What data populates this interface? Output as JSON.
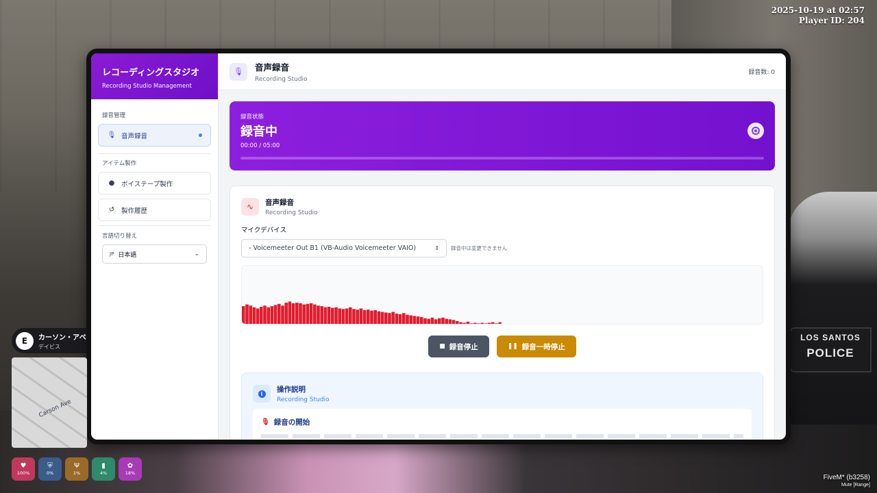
{
  "hud": {
    "datetime": "2025-10-19 at 02:57",
    "player_id": "Player ID: 204",
    "fivem": "FiveM* (b3258)",
    "mute": "Mute [Range]",
    "police_line1": "LOS SANTOS",
    "police_line2": "POLICE",
    "contact": {
      "initial": "E",
      "name": "カーソン・アベ",
      "sub": "デイビス"
    },
    "street": "Carson Ave",
    "stats": [
      {
        "icon": "heart-icon",
        "value": "100%",
        "color": "#c0395a"
      },
      {
        "icon": "shield-icon",
        "value": "0%",
        "color": "#3b5b8a"
      },
      {
        "icon": "food-icon",
        "value": "1%",
        "color": "#9a6a2a"
      },
      {
        "icon": "water-icon",
        "value": "4%",
        "color": "#2e8a6a"
      },
      {
        "icon": "brain-icon",
        "value": "18%",
        "color": "#a63bb5"
      }
    ]
  },
  "sidebar": {
    "title": "レコーディングスタジオ",
    "subtitle": "Recording Studio Management",
    "sections": [
      {
        "header": "録音管理",
        "items": [
          {
            "label": "音声録音",
            "icon": "mic-icon",
            "active": true
          }
        ]
      },
      {
        "header": "アイテム製作",
        "items": [
          {
            "label": "ボイステープ製作",
            "icon": "disc-icon"
          },
          {
            "label": "製作履歴",
            "icon": "history-icon"
          }
        ]
      },
      {
        "header": "言語切り替え"
      }
    ],
    "language": {
      "flag": "JP",
      "value": "日本語"
    }
  },
  "topbar": {
    "title": "音声録音",
    "subtitle": "Recording Studio",
    "count": "録音数: 0"
  },
  "status": {
    "label": "録音状態",
    "state": "録音中",
    "time": "00:00 / 05:00",
    "progress": 0
  },
  "recorder": {
    "title": "音声録音",
    "subtitle": "Recording Studio",
    "mic_label": "マイクデバイス",
    "mic_value": "- Voicemeeter Out B1 (VB-Audio Voicemeeter VAIO)",
    "mic_note": "録音中は変更できません",
    "waveform_color": "#e11d2e",
    "waveform_levels": [
      0.32,
      0.35,
      0.33,
      0.3,
      0.28,
      0.31,
      0.33,
      0.3,
      0.32,
      0.34,
      0.36,
      0.33,
      0.38,
      0.4,
      0.37,
      0.38,
      0.37,
      0.35,
      0.36,
      0.37,
      0.35,
      0.33,
      0.32,
      0.3,
      0.31,
      0.29,
      0.3,
      0.28,
      0.27,
      0.28,
      0.3,
      0.27,
      0.26,
      0.28,
      0.25,
      0.26,
      0.24,
      0.25,
      0.23,
      0.22,
      0.21,
      0.2,
      0.22,
      0.19,
      0.18,
      0.2,
      0.17,
      0.16,
      0.15,
      0.14,
      0.13,
      0.11,
      0.1,
      0.12,
      0.09,
      0.11,
      0.12,
      0.1,
      0.09,
      0.08,
      0.06,
      0.04,
      0.03,
      0.05,
      0.02,
      0.03,
      0.02,
      0.03,
      0.02,
      0.03,
      0.04,
      0.02,
      0.04
    ],
    "stop_label": "録音停止",
    "pause_label": "録音一時停止"
  },
  "help": {
    "title": "操作説明",
    "subtitle": "Recording Studio",
    "section_title": "録音の開始"
  }
}
